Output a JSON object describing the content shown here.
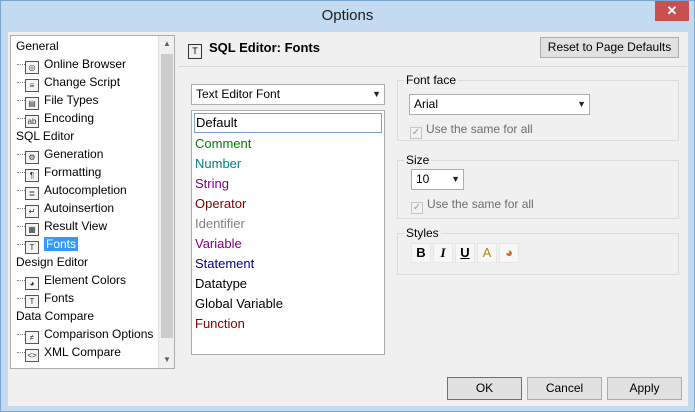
{
  "window": {
    "title": "Options",
    "close_glyph": "✕"
  },
  "tree": {
    "items": [
      {
        "label": "General",
        "level": 0
      },
      {
        "label": "Online Browser",
        "level": 1,
        "icon": "globe-icon",
        "glyph": "◎"
      },
      {
        "label": "Change Script",
        "level": 1,
        "icon": "script-icon",
        "glyph": "≡"
      },
      {
        "label": "File Types",
        "level": 1,
        "icon": "file-icon",
        "glyph": "▤"
      },
      {
        "label": "Encoding",
        "level": 1,
        "icon": "encoding-icon",
        "glyph": "ab"
      },
      {
        "label": "SQL Editor",
        "level": 0
      },
      {
        "label": "Generation",
        "level": 1,
        "icon": "gear-icon",
        "glyph": "⚙"
      },
      {
        "label": "Formatting",
        "level": 1,
        "icon": "formatting-icon",
        "glyph": "¶"
      },
      {
        "label": "Autocompletion",
        "level": 1,
        "icon": "autocomplete-icon",
        "glyph": "≣"
      },
      {
        "label": "Autoinsertion",
        "level": 1,
        "icon": "autoinsert-icon",
        "glyph": "↵"
      },
      {
        "label": "Result View",
        "level": 1,
        "icon": "grid-icon",
        "glyph": "▦"
      },
      {
        "label": "Fonts",
        "level": 1,
        "icon": "font-icon",
        "glyph": "T",
        "selected": true
      },
      {
        "label": "Design Editor",
        "level": 0
      },
      {
        "label": "Element Colors",
        "level": 1,
        "icon": "palette-icon",
        "glyph": "◕"
      },
      {
        "label": "Fonts",
        "level": 1,
        "icon": "font-icon",
        "glyph": "T"
      },
      {
        "label": "Data Compare",
        "level": 0
      },
      {
        "label": "Comparison Options",
        "level": 1,
        "icon": "compare-icon",
        "glyph": "≠"
      },
      {
        "label": "XML Compare",
        "level": 1,
        "icon": "xml-icon",
        "glyph": "<>"
      }
    ]
  },
  "panel": {
    "title": "SQL Editor: Fonts",
    "title_icon_glyph": "T",
    "reset_label": "Reset to Page Defaults",
    "font_target_select": "Text Editor Font",
    "elements": [
      {
        "label": "Default",
        "color": "#000000"
      },
      {
        "label": "Comment",
        "color": "#008000"
      },
      {
        "label": "Number",
        "color": "#008080"
      },
      {
        "label": "String",
        "color": "#800080"
      },
      {
        "label": "Operator",
        "color": "#800000"
      },
      {
        "label": "Identifier",
        "color": "#808080"
      },
      {
        "label": "Variable",
        "color": "#800080"
      },
      {
        "label": "Statement",
        "color": "#000080"
      },
      {
        "label": "Datatype",
        "color": "#000000"
      },
      {
        "label": "Global Variable",
        "color": "#000000"
      },
      {
        "label": "Function",
        "color": "#800000"
      }
    ],
    "font_face": {
      "group_label": "Font face",
      "value": "Arial",
      "same_for_all_label": "Use the same for all",
      "check_glyph": "✓"
    },
    "size": {
      "group_label": "Size",
      "value": "10",
      "same_for_all_label": "Use the same for all",
      "check_glyph": "✓"
    },
    "styles": {
      "group_label": "Styles",
      "bold": "B",
      "italic": "I",
      "underline": "U",
      "fore_color_glyph": "A",
      "back_color_glyph": "◕"
    }
  },
  "footer": {
    "ok": "OK",
    "cancel": "Cancel",
    "apply": "Apply"
  }
}
